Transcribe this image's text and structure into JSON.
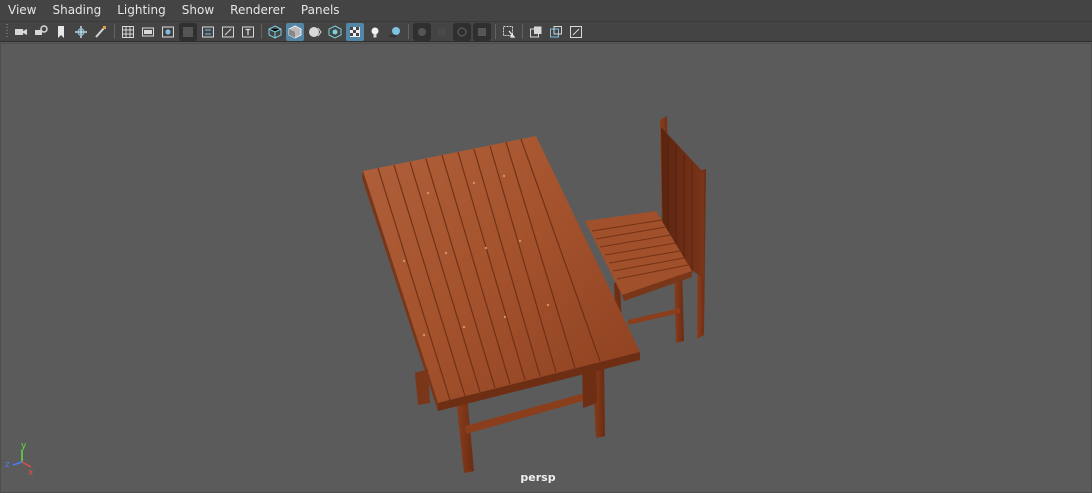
{
  "menu": {
    "items": [
      "View",
      "Shading",
      "Lighting",
      "Show",
      "Renderer",
      "Panels"
    ]
  },
  "toolbar": {
    "groups": [
      [
        "camera-icon",
        "camera-attribute-icon",
        "bookmark-icon",
        "image-plane-icon",
        "paint-icon"
      ],
      [
        "grid-icon",
        "film-gate-icon",
        "resolution-gate-icon",
        "gate-mask-icon",
        "field-chart-icon",
        "safe-action-icon",
        "safe-title-icon"
      ],
      [
        "wireframe-icon",
        "smooth-shade-icon",
        "wireframe-on-shaded-icon",
        "default-material-icon",
        "textured-icon",
        "use-all-lights-icon",
        "shadows-icon"
      ],
      [
        "isolate-select-icon",
        "xray-icon",
        "xray-joints-icon",
        "xray-active-icon"
      ],
      [
        "select-camera-icon"
      ],
      [
        "single-view-icon",
        "two-panes-icon",
        "four-panes-icon"
      ]
    ],
    "active": [
      "smooth-shade-icon",
      "textured-icon"
    ]
  },
  "viewport": {
    "camera_label": "persp",
    "axis_labels": {
      "x": "x",
      "y": "y",
      "z": "z"
    },
    "colors": {
      "background": "#5b5b5b",
      "wood_light": "#a5532c",
      "wood_dark": "#6a2c12",
      "axis_x": "#e34b4b",
      "axis_y": "#5fdc47",
      "axis_z": "#4a7ef0"
    }
  }
}
